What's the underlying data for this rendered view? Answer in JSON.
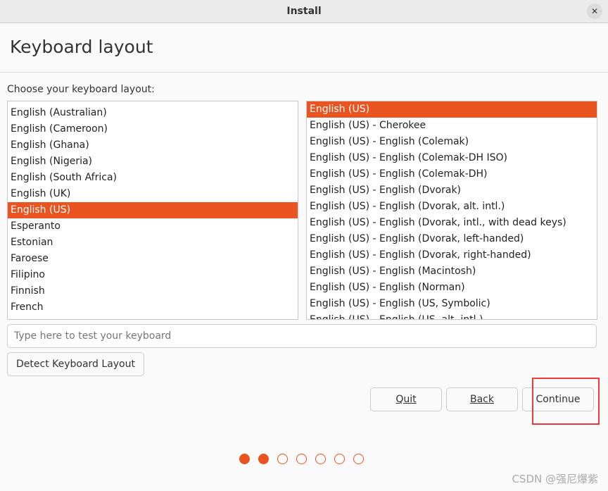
{
  "window": {
    "title": "Install",
    "close_icon": "close-icon"
  },
  "page": {
    "title": "Keyboard layout",
    "prompt": "Choose your keyboard layout:"
  },
  "layouts": [
    "English (Australian)",
    "English (Cameroon)",
    "English (Ghana)",
    "English (Nigeria)",
    "English (South Africa)",
    "English (UK)",
    "English (US)",
    "Esperanto",
    "Estonian",
    "Faroese",
    "Filipino",
    "Finnish",
    "French"
  ],
  "layouts_selected": "English (US)",
  "variants": [
    "English (US)",
    "English (US) - Cherokee",
    "English (US) - English (Colemak)",
    "English (US) - English (Colemak-DH ISO)",
    "English (US) - English (Colemak-DH)",
    "English (US) - English (Dvorak)",
    "English (US) - English (Dvorak, alt. intl.)",
    "English (US) - English (Dvorak, intl., with dead keys)",
    "English (US) - English (Dvorak, left-handed)",
    "English (US) - English (Dvorak, right-handed)",
    "English (US) - English (Macintosh)",
    "English (US) - English (Norman)",
    "English (US) - English (US, Symbolic)",
    "English (US) - English (US, alt. intl.)"
  ],
  "variants_selected": "English (US)",
  "test_input": {
    "placeholder": "Type here to test your keyboard",
    "value": ""
  },
  "buttons": {
    "detect": "Detect Keyboard Layout",
    "quit": "Quit",
    "back": "Back",
    "continue": "Continue"
  },
  "progress": {
    "current_step": 2,
    "total_steps": 7
  },
  "watermark": "CSDN @强尼爆紫",
  "colors": {
    "accent": "#e95420",
    "highlight_box": "#f03a3a"
  }
}
